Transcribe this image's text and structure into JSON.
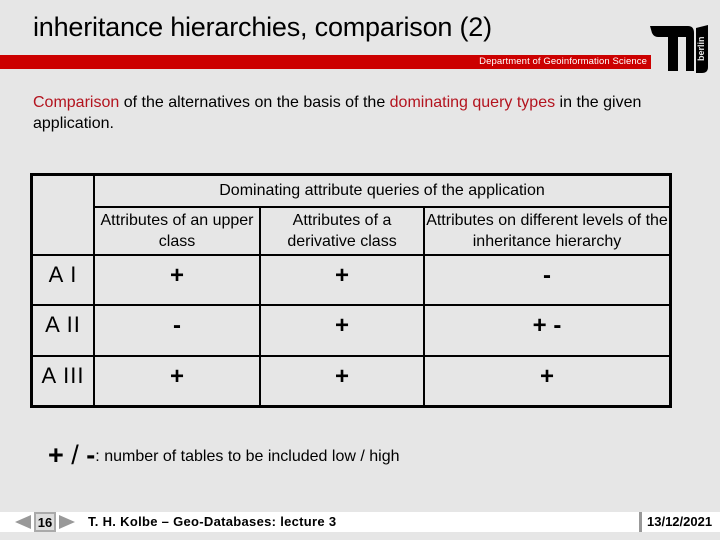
{
  "slide": {
    "title": "inheritance hierarchies, comparison (2)",
    "department": "Department of Geoinformation Science",
    "logo": {
      "text": "berlin",
      "icon": "tu-berlin-logo-icon"
    },
    "colors": {
      "accent": "#cc0000",
      "highlight": "#b3131e",
      "background": "#e6e6e6"
    }
  },
  "intro": {
    "part1": "Comparison",
    "part2": " of the alternatives on the basis of the ",
    "part3": "dominating query types",
    "part4": " in the given application."
  },
  "table": {
    "group_header": "Dominating attribute queries of the application",
    "columns": [
      "Attributes of an upper class",
      "Attributes of a derivative class",
      "Attributes on different levels of the inheritance hierarchy"
    ],
    "rows": [
      {
        "label": "A I",
        "cells": [
          "+",
          "+",
          "-"
        ]
      },
      {
        "label": "A II",
        "cells": [
          "-",
          "+",
          "+ -"
        ]
      },
      {
        "label": "A III",
        "cells": [
          "+",
          "+",
          "+"
        ]
      }
    ]
  },
  "legend": {
    "plus": "+",
    "slash": " / ",
    "minus": "-",
    "text": ": number of tables to be included low / high"
  },
  "footer": {
    "page_number": "16",
    "prev_icon": "triangle-left-icon",
    "next_icon": "triangle-right-icon",
    "author_line": "T. H. Kolbe  – Geo-Databases: lecture 3",
    "date": "13/12/2021"
  }
}
